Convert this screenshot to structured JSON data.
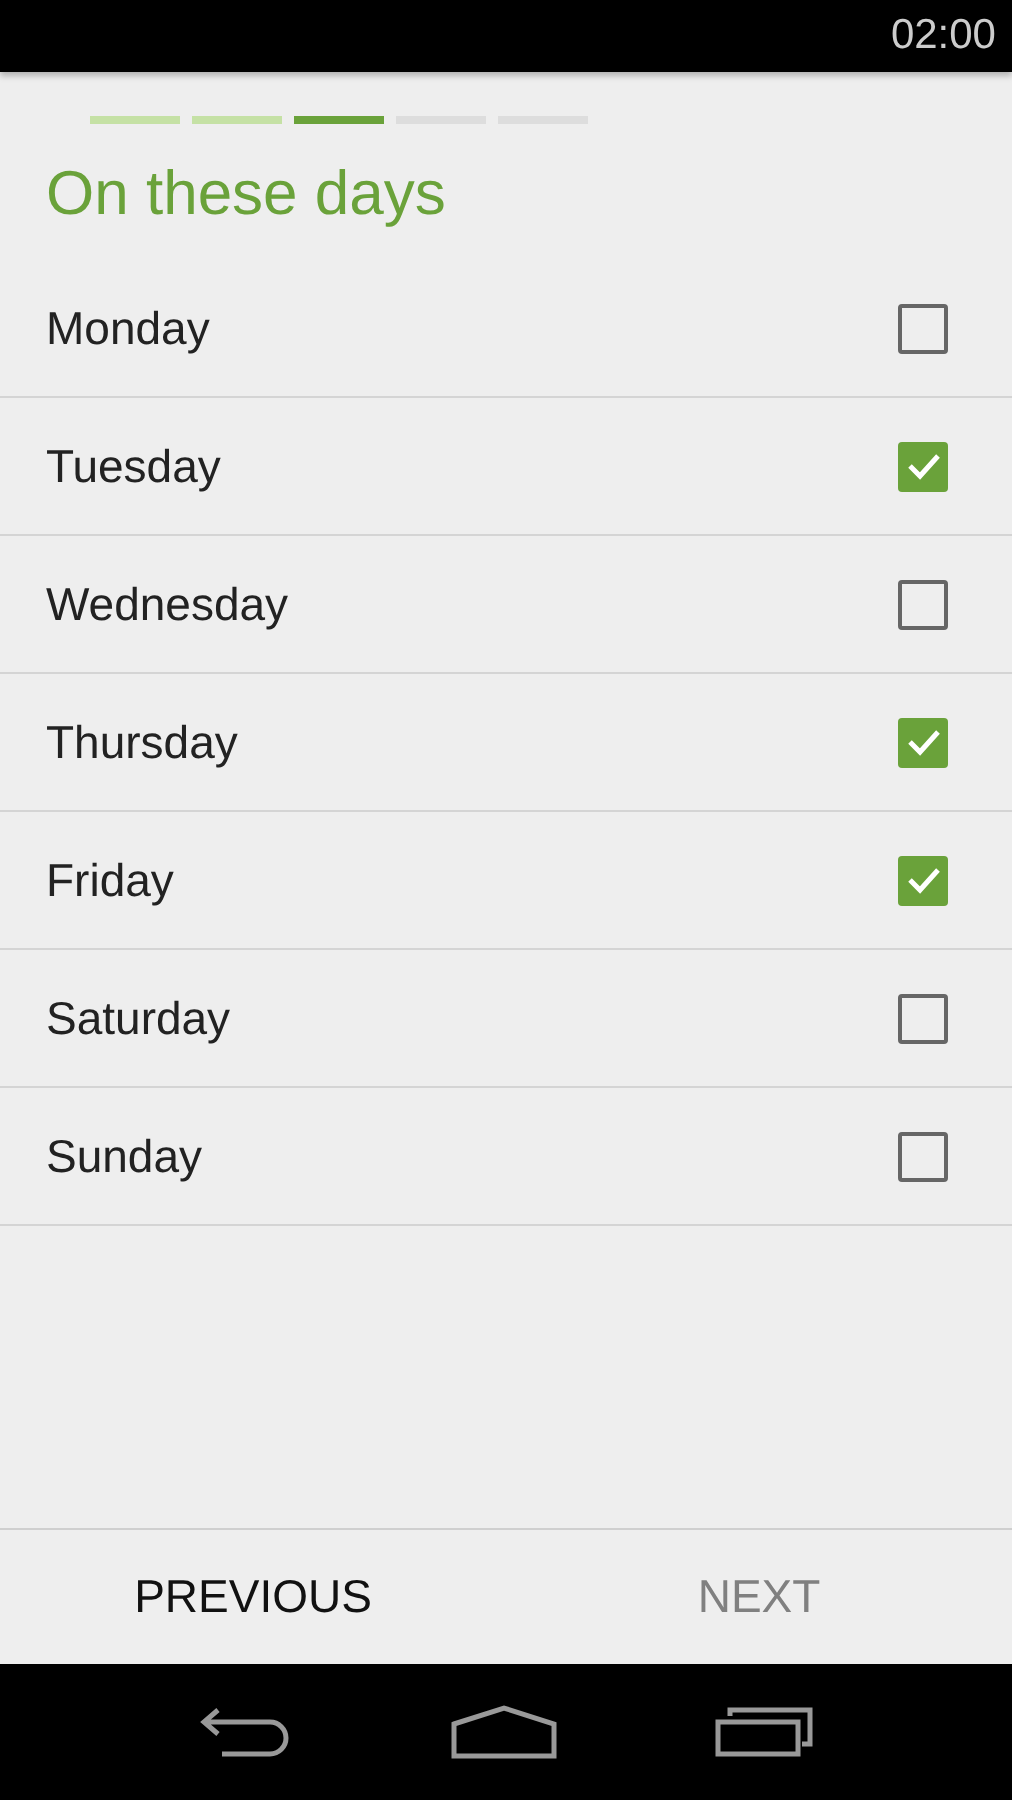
{
  "status_bar": {
    "time": "02:00"
  },
  "steps": [
    {
      "done": true,
      "selected": false
    },
    {
      "done": true,
      "selected": false
    },
    {
      "done": false,
      "selected": true
    },
    {
      "done": false,
      "selected": false
    },
    {
      "done": false,
      "selected": false
    }
  ],
  "title": "On these days",
  "days": [
    {
      "label": "Monday",
      "checked": false
    },
    {
      "label": "Tuesday",
      "checked": true
    },
    {
      "label": "Wednesday",
      "checked": false
    },
    {
      "label": "Thursday",
      "checked": true
    },
    {
      "label": "Friday",
      "checked": true
    },
    {
      "label": "Saturday",
      "checked": false
    },
    {
      "label": "Sunday",
      "checked": false
    }
  ],
  "buttons": [
    {
      "label": "PREVIOUS",
      "disabled": false
    },
    {
      "label": "NEXT",
      "disabled": true
    }
  ]
}
